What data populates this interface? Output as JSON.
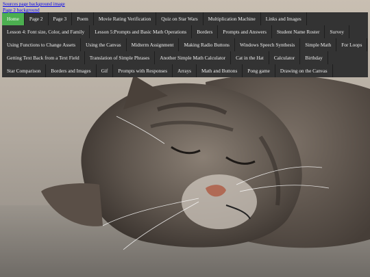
{
  "top_links": [
    {
      "label": "Sources page background image"
    },
    {
      "label": "Page 2 background"
    }
  ],
  "colors": {
    "nav_bg": "#333333",
    "active_bg": "#4caf50",
    "nav_text": "#f2f2f2",
    "link": "#0000ee"
  },
  "nav": {
    "active_index": 0,
    "items": [
      {
        "label": "Home"
      },
      {
        "label": "Page 2"
      },
      {
        "label": "Page 3"
      },
      {
        "label": "Poem"
      },
      {
        "label": "Movie Rating Verification"
      },
      {
        "label": "Quiz on Star Wars"
      },
      {
        "label": "Multiplication Machine"
      },
      {
        "label": "Links and Images"
      },
      {
        "label": "Lesson 4: Font size, Color, and Family"
      },
      {
        "label": "Lesson 5:Prompts and Basic Math Operations"
      },
      {
        "label": "Borders"
      },
      {
        "label": "Prompts and Answers"
      },
      {
        "label": "Student Name Roster"
      },
      {
        "label": "Survey"
      },
      {
        "label": "Using Functions to Change Assets"
      },
      {
        "label": "Using the Canvas"
      },
      {
        "label": "Midterm Assignment"
      },
      {
        "label": "Making Radio Buttons"
      },
      {
        "label": "Windows Speech Synthesis"
      },
      {
        "label": "Simple Math"
      },
      {
        "label": "For Loops"
      },
      {
        "label": "Getting Text Back from a Text Field"
      },
      {
        "label": "Translation of Simple Phrases"
      },
      {
        "label": "Another Simple Math Calculator"
      },
      {
        "label": "Cat in the Hat"
      },
      {
        "label": "Calculator"
      },
      {
        "label": "Birthday"
      },
      {
        "label": "Star Comparison"
      },
      {
        "label": "Borders and Images"
      },
      {
        "label": "Gif"
      },
      {
        "label": "Prompts with Responses"
      },
      {
        "label": "Arrays"
      },
      {
        "label": "Math and Buttons"
      },
      {
        "label": "Pong game"
      },
      {
        "label": "Drawing on the Canvas"
      }
    ]
  }
}
